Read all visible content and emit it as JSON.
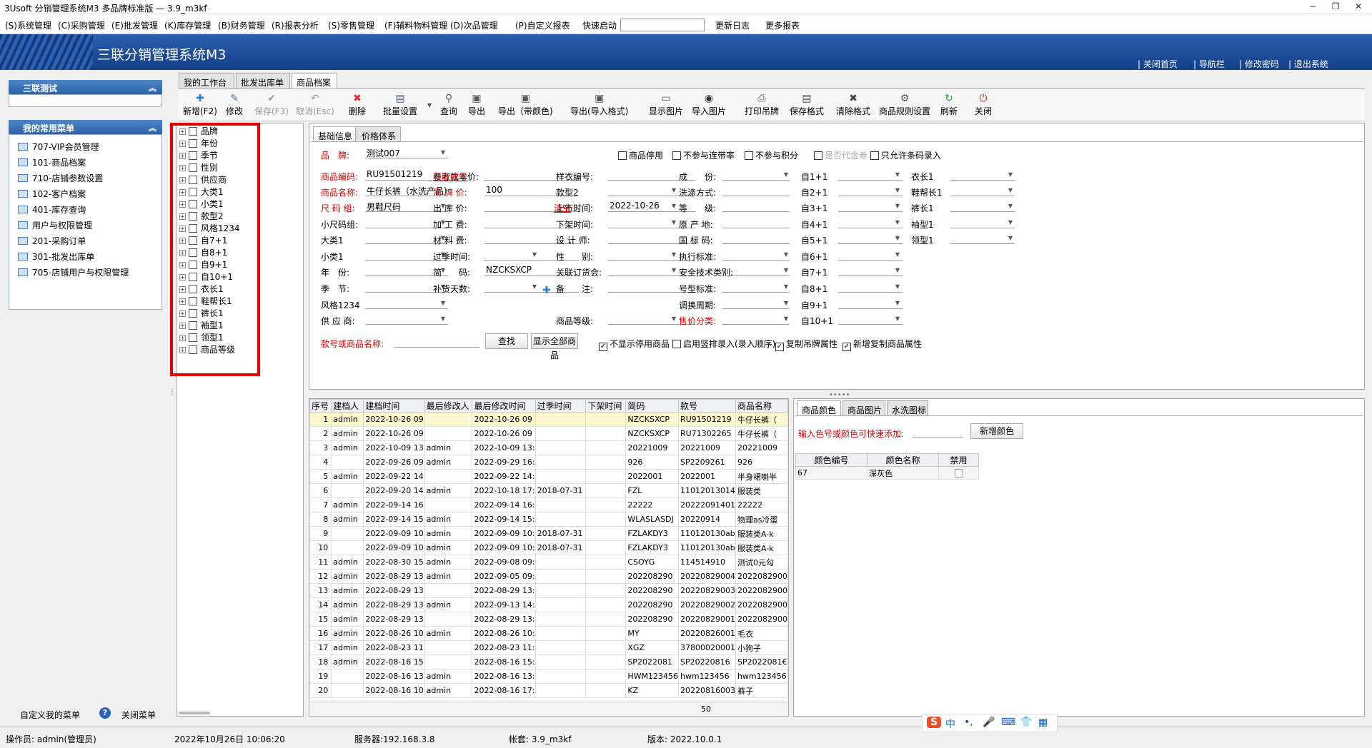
{
  "window": {
    "title": "3Usoft 分销管理系统M3 多品牌标准版 — 3.9_m3kf",
    "min": "−",
    "restore": "❐",
    "close": "✕"
  },
  "menu": [
    "(S)系统管理",
    "(C)采购管理",
    "(E)批发管理",
    "(K)库存管理",
    "(B)财务管理",
    "(R)报表分析",
    "(S)零售管理",
    "(F)辅料物料管理",
    "(D)次品管理",
    "(P)自定义报表",
    "快速启动",
    "更新日志",
    "更多报表"
  ],
  "banner": {
    "title": "三联分销管理系统M3",
    "links": [
      "| 关闭首页",
      "| 导航栏",
      "| 修改密码",
      "| 退出系统"
    ]
  },
  "left": {
    "section1": "三联测试",
    "section2": "我的常用菜单",
    "favorites": [
      "707-VIP会员管理",
      "101-商品档案",
      "710-店铺参数设置",
      "102-客户档案",
      "401-库存查询",
      "用户与权限管理",
      "201-采购订单",
      "301-批发出库单",
      "705-店铺用户与权限管理"
    ],
    "customize": "自定义我的菜单",
    "close_menu": "关闭菜单",
    "help": "?"
  },
  "tabs": [
    "我的工作台",
    "批发出库单",
    "商品档案"
  ],
  "toolbar": [
    {
      "label": "新增(F2)",
      "icon": "✚",
      "dis": false
    },
    {
      "label": "修改",
      "icon": "✎",
      "dis": false
    },
    {
      "label": "保存(F3)",
      "icon": "✔",
      "dis": true
    },
    {
      "label": "取消(Esc)",
      "icon": "↶",
      "dis": true
    },
    {
      "label": "删除",
      "icon": "✖",
      "dis": false
    },
    {
      "label": "批量设置",
      "icon": "▤",
      "dis": false
    },
    {
      "label": "查询",
      "icon": "⚲",
      "dis": false
    },
    {
      "label": "导出",
      "icon": "▣",
      "dis": false
    },
    {
      "label": "导出（带颜色)",
      "icon": "▣",
      "dis": false
    },
    {
      "label": "导出(导入格式)",
      "icon": "▣",
      "dis": false
    },
    {
      "label": "显示图片",
      "icon": "▭",
      "dis": false
    },
    {
      "label": "导入图片",
      "icon": "◉",
      "dis": false
    },
    {
      "label": "打印吊牌",
      "icon": "⎙",
      "dis": false
    },
    {
      "label": "保存格式",
      "icon": "▤",
      "dis": false
    },
    {
      "label": "清除格式",
      "icon": "✖",
      "dis": false
    },
    {
      "label": "商品规则设置",
      "icon": "⚙",
      "dis": false
    },
    {
      "label": "刷新",
      "icon": "↻",
      "dis": false
    },
    {
      "label": "关闭",
      "icon": "⏻",
      "dis": false
    }
  ],
  "tree": [
    "品牌",
    "年份",
    "季节",
    "性别",
    "供应商",
    "大类1",
    "小类1",
    "款型2",
    "风格1234",
    "自7+1",
    "自8+1",
    "自9+1",
    "自10+1",
    "衣长1",
    "鞋帮长1",
    "裤长1",
    "袖型1",
    "领型1",
    "商品等级"
  ],
  "form": {
    "subtabs": [
      "基础信息",
      "价格体系"
    ],
    "brand_label": "品　牌:",
    "brand_value": "测试007",
    "checks": [
      "商品停用",
      "不参与连带率",
      "不参与积分",
      "是否代金券",
      "只允许条码录入"
    ],
    "col1": [
      {
        "l": "商品编码:",
        "v": "RU91501219",
        "red": true
      },
      {
        "l": "商品名称:",
        "v": "牛仔长裤（水洗产品）",
        "red": true
      },
      {
        "l": "尺 码 组:",
        "v": "男鞋尺码",
        "red": true,
        "dd": true
      },
      {
        "l": "小尺码组:",
        "v": "",
        "dd": true
      },
      {
        "l": "大类1",
        "v": "",
        "dd": true
      },
      {
        "l": "小类1",
        "v": "",
        "dd": true
      },
      {
        "l": "年　份:",
        "v": "",
        "dd": true
      },
      {
        "l": "季　节:",
        "v": "",
        "dd": true
      },
      {
        "l": "风格1234",
        "v": "",
        "dd": true
      },
      {
        "l": "供 应 商:",
        "v": "",
        "dd": true
      }
    ],
    "fetch_code": "获取款号",
    "col2": [
      {
        "l": "参考成本价:",
        "v": ""
      },
      {
        "l": "吊 牌 价:",
        "v": "100",
        "red": true
      },
      {
        "l": "出 库 价:",
        "v": ""
      },
      {
        "l": "加 工 费:",
        "v": ""
      },
      {
        "l": "材 料 费:",
        "v": ""
      },
      {
        "l": "过季时间:",
        "v": "",
        "dd": true
      },
      {
        "l": "简　　码:",
        "v": "NZCKSXCP"
      },
      {
        "l": "补货天数:",
        "v": "",
        "dd": true
      }
    ],
    "clear": "清空",
    "col3": [
      {
        "l": "样衣编号:",
        "v": ""
      },
      {
        "l": "款型2",
        "v": "",
        "dd": true
      },
      {
        "l": "上市时间:",
        "v": "2022-10-26",
        "dd": true
      },
      {
        "l": "下架时间:",
        "v": "",
        "dd": true
      },
      {
        "l": "设 计 师:",
        "v": ""
      },
      {
        "l": "性　　别:",
        "v": "",
        "dd": true
      },
      {
        "l": "关联订货会:",
        "v": "",
        "dd": true
      },
      {
        "l": "备　　注:",
        "v": ""
      },
      {
        "l": "",
        "v": ""
      },
      {
        "l": "商品等级:",
        "v": "",
        "dd": true
      }
    ],
    "col4": [
      {
        "l": "成　　份:",
        "v": "",
        "dd": true
      },
      {
        "l": "洗涤方式:",
        "v": ""
      },
      {
        "l": "等　　级:",
        "v": ""
      },
      {
        "l": "原 产 地:",
        "v": ""
      },
      {
        "l": "国 标 码:",
        "v": ""
      },
      {
        "l": "执行标准:",
        "v": "",
        "dd": true
      },
      {
        "l": "安全技术类别:",
        "v": "",
        "dd": true
      },
      {
        "l": "号型标准:",
        "v": "",
        "dd": true
      },
      {
        "l": "调换周期:",
        "v": "",
        "dd": true
      },
      {
        "l": "售价分类:",
        "v": "",
        "dd": true,
        "red": true
      }
    ],
    "col5": [
      "自1+1",
      "自2+1",
      "自3+1",
      "自4+1",
      "自5+1",
      "自6+1",
      "自7+1",
      "自8+1",
      "自9+1",
      "自10+1"
    ],
    "col6": [
      "衣长1",
      "鞋帮长1",
      "裤长1",
      "袖型1",
      "领型1"
    ],
    "search_label": "款号或商品名称:",
    "search_btn": "查找",
    "show_all_btn": "显示全部商品",
    "opts": [
      {
        "t": "不显示停用商品",
        "c": true
      },
      {
        "t": "启用竖排录入(录入顺序)",
        "c": false
      },
      {
        "t": "复制吊牌属性",
        "c": true
      },
      {
        "t": "新增复制商品属性",
        "c": true
      }
    ]
  },
  "grid": {
    "headers": [
      "序号",
      "建档人",
      "建档时间",
      "最后修改人",
      "最后修改时间",
      "过季时间",
      "下架时间",
      "简码",
      "款号",
      "商品名称"
    ],
    "rows": [
      [
        "1",
        "admin",
        "2022-10-26 09",
        "",
        "2022-10-26 09",
        "",
        "",
        "NZCKSXCP",
        "RU91501219",
        "牛仔长裤（"
      ],
      [
        "2",
        "admin",
        "2022-10-26 09",
        "",
        "2022-10-26 09",
        "",
        "",
        "NZCKSXCP",
        "RU71302265",
        "牛仔长裤（"
      ],
      [
        "3",
        "admin",
        "2022-10-09 13",
        "admin",
        "2022-10-09 13:",
        "",
        "",
        "20221009",
        "20221009",
        "20221009"
      ],
      [
        "4",
        "",
        "2022-09-26 09",
        "admin",
        "2022-09-29 16:",
        "",
        "",
        "926",
        "SP2209261",
        "926"
      ],
      [
        "5",
        "admin",
        "2022-09-22 14",
        "",
        "2022-09-22 14:",
        "",
        "",
        "2022001",
        "2022001",
        "半身裙喇半"
      ],
      [
        "6",
        "",
        "2022-09-20 14",
        "admin",
        "2022-10-18 17:",
        "2018-07-31",
        "",
        "FZL",
        "11012013014",
        "服装类"
      ],
      [
        "7",
        "admin",
        "2022-09-14 16",
        "",
        "2022-09-14 16:",
        "",
        "",
        "22222",
        "20222091401",
        "22222"
      ],
      [
        "8",
        "admin",
        "2022-09-14 15",
        "admin",
        "2022-09-14 15:",
        "",
        "",
        "WLASLASDJ",
        "20220914",
        "物理as冷蛋"
      ],
      [
        "9",
        "",
        "2022-09-09 10",
        "admin",
        "2022-09-09 10:",
        "2018-07-31",
        "",
        "FZLAKDY3",
        "110120130ab",
        "服装类A-k"
      ],
      [
        "10",
        "",
        "2022-09-09 10",
        "admin",
        "2022-09-09 10:",
        "2018-07-31",
        "",
        "FZLAKDY3",
        "110120130ab",
        "服装类A-k"
      ],
      [
        "11",
        "admin",
        "2022-08-30 15",
        "admin",
        "2022-09-08 09:",
        "",
        "",
        "CSOYG",
        "114514910",
        "测试0元勾"
      ],
      [
        "12",
        "admin",
        "2022-08-29 13",
        "admin",
        "2022-09-05 09:",
        "",
        "",
        "202208290",
        "20220829004",
        "2022082900"
      ],
      [
        "13",
        "admin",
        "2022-08-29 13",
        "",
        "2022-08-29 13:",
        "",
        "",
        "202208290",
        "20220829003",
        "2022082900"
      ],
      [
        "14",
        "admin",
        "2022-08-29 13",
        "admin",
        "2022-09-13 14:",
        "",
        "",
        "202208290",
        "20220829002",
        "2022082900"
      ],
      [
        "15",
        "admin",
        "2022-08-29 13",
        "",
        "2022-08-29 13:",
        "",
        "",
        "202208290",
        "20220829001",
        "2022082900"
      ],
      [
        "16",
        "admin",
        "2022-08-26 10",
        "admin",
        "2022-08-26 10:",
        "",
        "",
        "MY",
        "20220826001",
        "毛衣"
      ],
      [
        "17",
        "admin",
        "2022-08-23 11",
        "",
        "2022-08-23 11:",
        "",
        "",
        "XGZ",
        "37800020001",
        "小狗子"
      ],
      [
        "18",
        "admin",
        "2022-08-16 15",
        "",
        "2022-08-16 15:",
        "",
        "",
        "SP2022081",
        "SP20220816",
        "SP2022081€"
      ],
      [
        "19",
        "",
        "2022-08-16 13",
        "admin",
        "2022-08-16 13:",
        "",
        "",
        "HWM123456",
        "hwm123456",
        "hwm123456"
      ],
      [
        "20",
        "",
        "2022-08-16 10",
        "admin",
        "2022-08-16 17:",
        "",
        "",
        "KZ",
        "20220816003",
        "裤子"
      ]
    ],
    "footer_count": "50"
  },
  "color": {
    "tabs": [
      "商品颜色",
      "商品图片",
      "水洗图标"
    ],
    "hint": "输入色号或颜色可快速添加:",
    "add_btn": "新增颜色",
    "headers": [
      "颜色编号",
      "颜色名称",
      "禁用"
    ],
    "rows": [
      [
        "67",
        "深灰色"
      ]
    ]
  },
  "status": [
    "操作员: admin(管理员)",
    "2022年10月26日 10:06:20",
    "服务器:192.168.3.8",
    "帐套: 3.9_m3kf",
    "版本: 2022.10.0.1"
  ],
  "ime": [
    "S",
    "中",
    "•,",
    "🎤",
    "⌨",
    "👕",
    "▦"
  ]
}
